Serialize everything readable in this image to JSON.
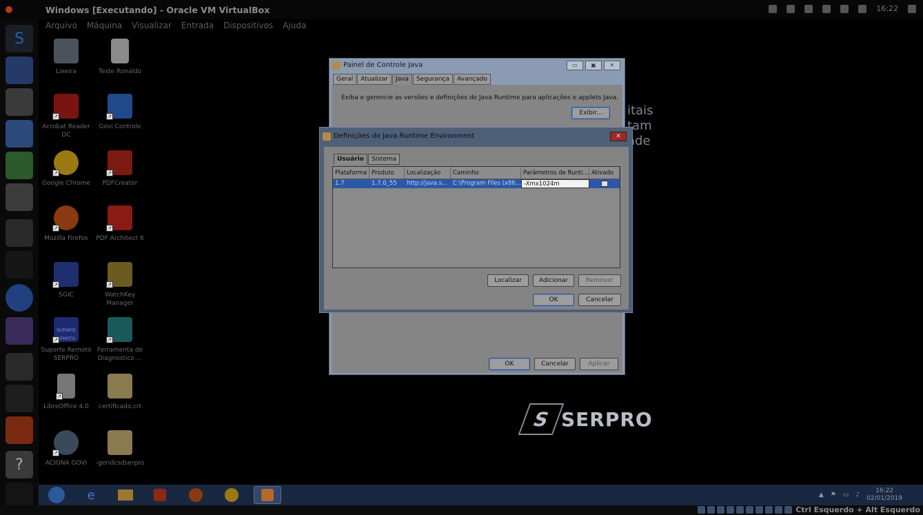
{
  "host": {
    "window_title": "Windows [Executando] - Oracle VM VirtualBox",
    "clock": "16:22",
    "menu": [
      "Arquivo",
      "Máquina",
      "Visualizar",
      "Entrada",
      "Dispositivos",
      "Ajuda"
    ]
  },
  "desktop_icons": [
    {
      "label": "Lixeira",
      "icon": "recycle-bin-icon"
    },
    {
      "label": "Teste Ronaldo",
      "icon": "text-file-icon"
    },
    {
      "label": "Acrobat Reader DC",
      "icon": "acrobat-icon"
    },
    {
      "label": "Govi Controle",
      "icon": "govi-icon"
    },
    {
      "label": "Google Chrome",
      "icon": "chrome-icon"
    },
    {
      "label": "PDFCreator",
      "icon": "pdfcreator-icon"
    },
    {
      "label": "Mozilla Firefox",
      "icon": "firefox-icon"
    },
    {
      "label": "PDF Architect 6",
      "icon": "pdf-architect-icon"
    },
    {
      "label": "SGIC",
      "icon": "sgic-icon"
    },
    {
      "label": "WatchKey Manager",
      "icon": "watchkey-icon"
    },
    {
      "label": "Suporte Remoto SERPRO",
      "icon": "suporte-remoto-icon",
      "badge": "SUPORTE REMOTO"
    },
    {
      "label": "Ferramenta de Diagnostico ...",
      "icon": "diagnostic-tool-icon"
    },
    {
      "label": "LibreOffice 4.0",
      "icon": "libreoffice-icon"
    },
    {
      "label": "certificado.crt",
      "icon": "certificate-icon"
    },
    {
      "label": "ACIONA GOVI",
      "icon": "aciona-govi-icon"
    },
    {
      "label": "-geridcsdserpro",
      "icon": "certificate-icon"
    }
  ],
  "background": {
    "text_lines": [
      "itais",
      "tam",
      "ade"
    ],
    "logo_text": "SERPRO"
  },
  "java_control_panel": {
    "title": "Painel de Controle Java",
    "tabs": [
      "Geral",
      "Atualizar",
      "Java",
      "Segurança",
      "Avançado"
    ],
    "active_tab": "Java",
    "description": "Exiba e gerencie as versões e definições do Java Runtime para aplicações e applets Java.",
    "view_button": "Exibir...",
    "ok": "OK",
    "cancel": "Cancelar",
    "apply": "Aplicar"
  },
  "jre_settings": {
    "title": "Definições do Java Runtime Environment",
    "tabs": [
      "Usuário",
      "Sistema"
    ],
    "active_tab": "Usuário",
    "columns": [
      "Plataforma",
      "Produto",
      "Localização",
      "Caminho",
      "Parâmetros de Runti...",
      "Ativado"
    ],
    "row": {
      "platform": "1.7",
      "product": "1.7.0_55",
      "location": "http://java.s...",
      "path": "C:\\Program Files (x86...",
      "params": "-Xmx1024m",
      "enabled": "✓"
    },
    "find_button": "Localizar",
    "add_button": "Adicionar",
    "remove_button": "Remover",
    "ok": "OK",
    "cancel": "Cancelar",
    "close": "✕"
  },
  "taskbar": {
    "time": "16:22",
    "date": "02/01/2019"
  },
  "status_bar": {
    "host_key": "Ctrl Esquerdo + Alt Esquerdo"
  }
}
